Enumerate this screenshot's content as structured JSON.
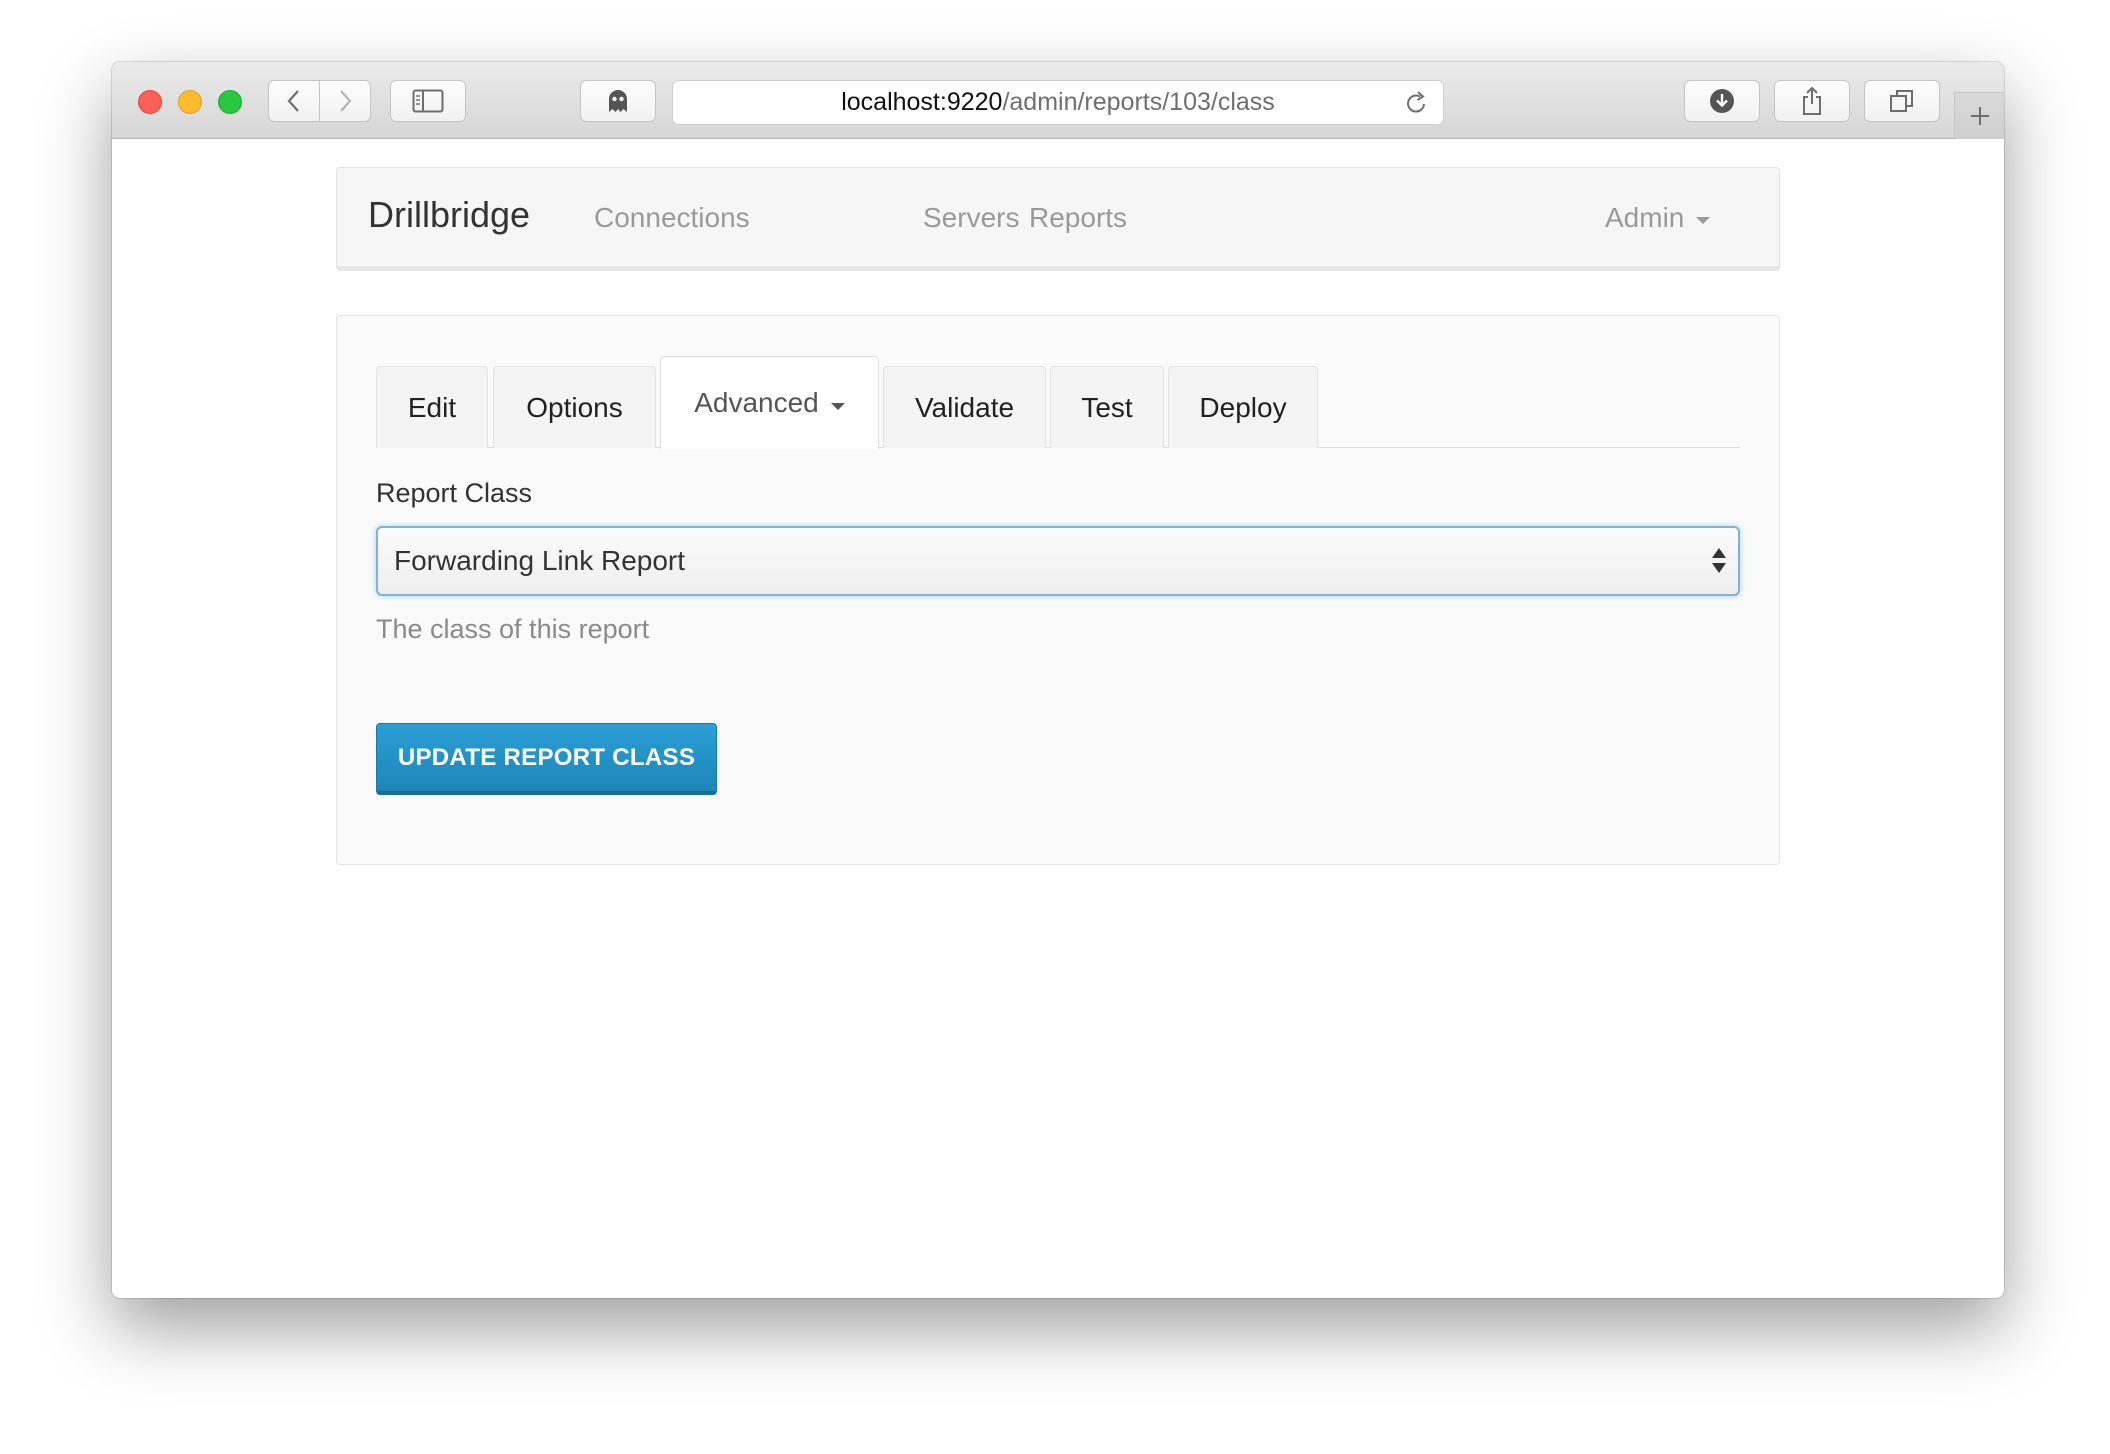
{
  "browser": {
    "url_host": "localhost:9220",
    "url_path": "/admin/reports/103/class"
  },
  "navbar": {
    "brand": "Drillbridge",
    "links": [
      "Connections",
      "Servers",
      "Reports"
    ],
    "admin": "Admin"
  },
  "tabs": {
    "edit": "Edit",
    "options": "Options",
    "advanced": "Advanced",
    "validate": "Validate",
    "test": "Test",
    "deploy": "Deploy",
    "active": "Advanced"
  },
  "form": {
    "label": "Report Class",
    "selected_value": "Forwarding Link Report",
    "help_text": "The class of this report",
    "submit_label": "UPDATE REPORT CLASS"
  },
  "colors": {
    "primary_button": "#2a9fd6",
    "focus_border": "#7eb3d9",
    "close": "#fc5f57",
    "minimize": "#fdbc2e",
    "zoom": "#28c840"
  }
}
